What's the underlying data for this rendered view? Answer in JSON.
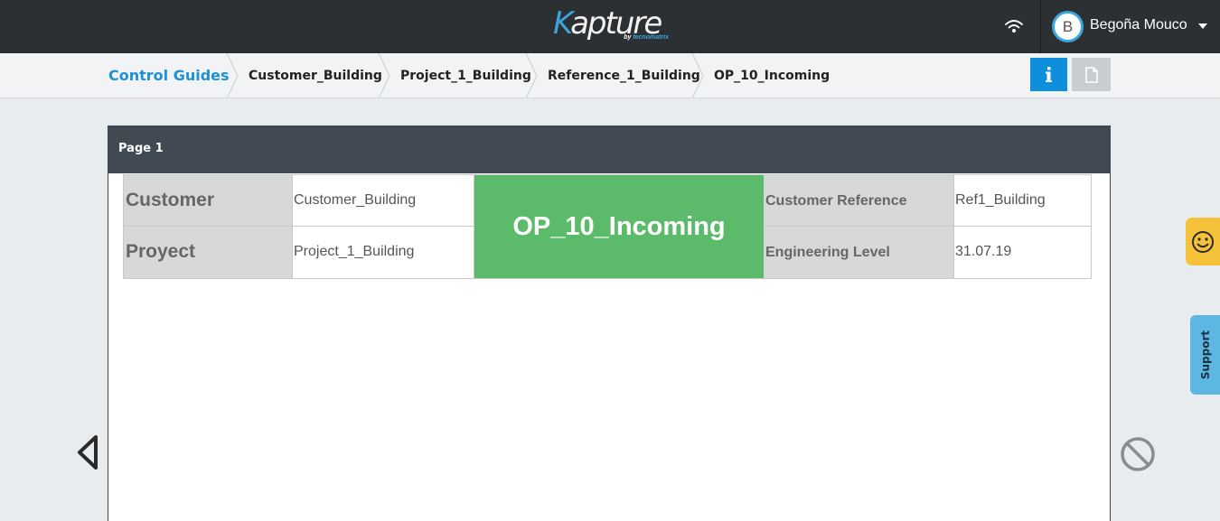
{
  "header": {
    "logo_text_accent": "K",
    "logo_text_rest": "apture",
    "logo_sub_prefix": "by ",
    "logo_sub_brand": "tecnomatrix",
    "user_initial": "B",
    "user_name": "Begoña Mouco",
    "icons": [
      "wifi-icon",
      "chevron-down-icon"
    ]
  },
  "breadcrumb": {
    "items": [
      "Control Guides",
      "Customer_Building",
      "Project_1_Building",
      "Reference_1_Building",
      "OP_10_Incoming"
    ]
  },
  "toolbar": {
    "icons": [
      "info-icon",
      "document-icon"
    ]
  },
  "page": {
    "title": "Page 1",
    "table": {
      "customer_label": "Customer",
      "customer_value": "Customer_Building",
      "project_label": "Proyect",
      "project_value": "Project_1_Building",
      "operation": "OP_10_Incoming",
      "customer_reference_label": "Customer Reference",
      "customer_reference_value": "Ref1_Building",
      "engineering_level_label": "Engineering Level",
      "engineering_level_value": "31.07.19"
    }
  },
  "side": {
    "support_label": "Support",
    "icons": [
      "previous-page-icon",
      "blocked-icon",
      "smiley-icon"
    ]
  },
  "colors": {
    "accent": "#1e90d6",
    "topbar": "#2d3033",
    "operation_green": "#5cba6b",
    "feedback_yellow": "#f5c23a",
    "support_blue": "#5cb8e2"
  }
}
